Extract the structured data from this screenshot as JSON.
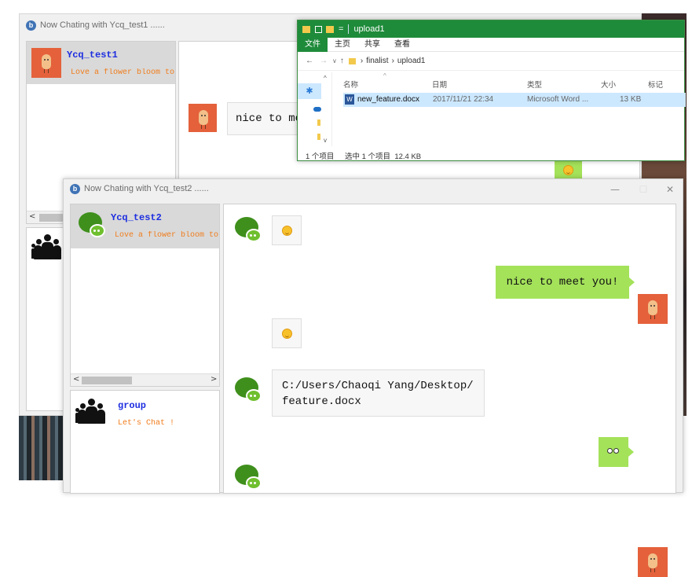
{
  "window1": {
    "title": "Now Chating with Ycq_test1 ......",
    "contact": {
      "name": "Ycq_test1",
      "status": "Love a flower bloom to ac"
    },
    "message_partial": "nice to me"
  },
  "explorer": {
    "title": "upload1",
    "ribbon_tabs": [
      "文件",
      "主页",
      "共享",
      "查看"
    ],
    "breadcrumb": [
      "finalist",
      "upload1"
    ],
    "columns": [
      "名称",
      "日期",
      "类型",
      "大小",
      "标记"
    ],
    "file": {
      "name": "new_feature.docx",
      "date": "2017/11/21 22:34",
      "type": "Microsoft Word ...",
      "size": "13 KB"
    },
    "status_count": "1 个项目",
    "status_selected": "选中 1 个项目  12.4 KB"
  },
  "window2": {
    "title": "Now Chating with Ycq_test2 ......",
    "contact": {
      "name": "Ycq_test2",
      "status": "Love a flower bloom to ac"
    },
    "group": {
      "name": "group",
      "status": "Let's Chat !"
    },
    "messages": {
      "m2": "nice to meet you!",
      "m4_line1": "C:/Users/Chaoqi Yang/Desktop/",
      "m4_line2": "feature.docx"
    },
    "controls": {
      "minimize": "—",
      "maximize": "☐",
      "close": "✕"
    }
  },
  "colors": {
    "accent_green": "#a4e25a",
    "explorer_green": "#1e8b3a",
    "contact_name": "#1d2ee0",
    "status_orange": "#f07d1d"
  }
}
